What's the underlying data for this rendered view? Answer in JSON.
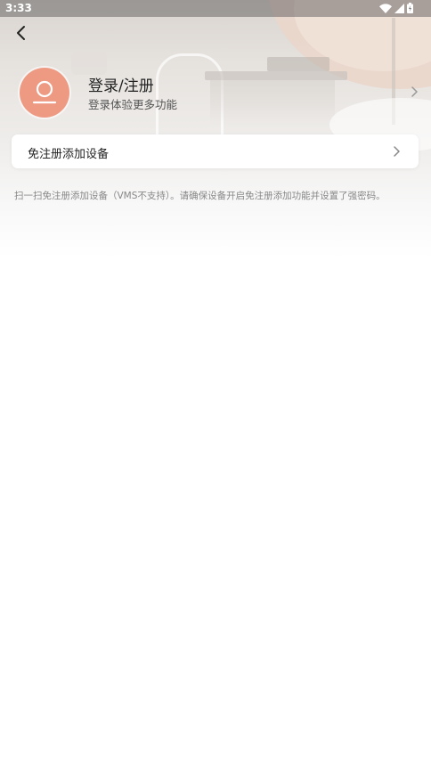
{
  "status_bar": {
    "time": "3:33",
    "icons": [
      "wifi-icon",
      "cellular-signal-icon",
      "battery-icon"
    ]
  },
  "header": {
    "back_icon": "chevron-left-icon"
  },
  "profile": {
    "title": "登录/注册",
    "subtitle": "登录体验更多功能",
    "avatar_icon": "user-avatar-icon",
    "avatar_color": "#ee9a83"
  },
  "menu": {
    "add_device_label": "免注册添加设备"
  },
  "hint": {
    "text": "扫一扫免注册添加设备（VMS不支持）。请确保设备开启免注册添加功能并设置了强密码。"
  }
}
